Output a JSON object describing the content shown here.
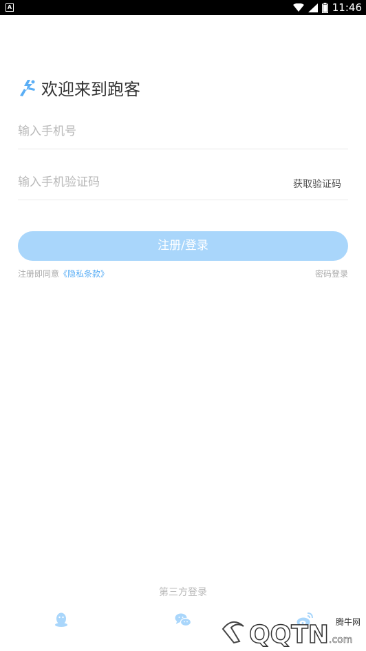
{
  "status_bar": {
    "left_icon": "A",
    "time": "11:46",
    "icons": [
      "wifi-icon",
      "signal-icon",
      "battery-icon"
    ]
  },
  "header": {
    "logo_icon": "runner-logo-icon",
    "title": "欢迎来到跑客"
  },
  "form": {
    "phone_placeholder": "输入手机号",
    "code_placeholder": "输入手机验证码",
    "get_code_label": "获取验证码",
    "submit_label": "注册/登录"
  },
  "agreement": {
    "prefix": "注册即同意",
    "link_label": "《隐私条款》",
    "password_login_label": "密码登录"
  },
  "third_party": {
    "title": "第三方登录",
    "providers": [
      "qq-icon",
      "wechat-icon",
      "weibo-icon"
    ]
  },
  "watermark": {
    "cn_text": "腾牛网",
    "en_text": "QQTN",
    "suffix": ".com"
  },
  "colors": {
    "accent": "#5aaef5",
    "button_bg": "#a9d6fb",
    "placeholder": "#b8b8b8"
  }
}
